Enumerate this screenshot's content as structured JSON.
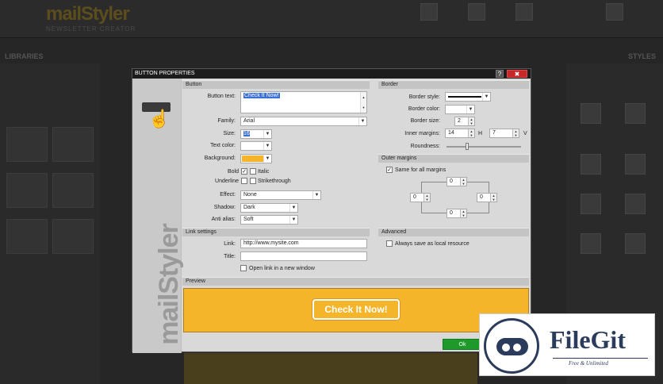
{
  "app": {
    "logo": "mailStyler",
    "logo_sub": "NEWSLETTER CREATOR",
    "libraries_title": "LIBRARIES",
    "styles_title": "STYLES"
  },
  "dialog": {
    "title": "BUTTON PROPERTIES",
    "help_label": "?",
    "close_label": "✖",
    "sidebar_wordmark": "mailStyler",
    "button_section": {
      "header": "Button",
      "button_text_label": "Button text:",
      "button_text_value": "Check It Now!",
      "family_label": "Family:",
      "family_value": "Arial",
      "size_label": "Size:",
      "size_value": "16",
      "text_color_label": "Text color:",
      "background_label": "Background:",
      "background_color": "#f5b52a",
      "bold_label": "Bold",
      "italic_label": "Italic",
      "underline_label": "Underline",
      "strikethrough_label": "Strikethrough",
      "effect_label": "Effect:",
      "effect_value": "None",
      "shadow_label": "Shadow:",
      "shadow_value": "Dark",
      "antialias_label": "Anti alias:",
      "antialias_value": "Soft"
    },
    "border_section": {
      "header": "Border",
      "style_label": "Border style:",
      "color_label": "Border color:",
      "size_label": "Border size:",
      "size_value": "2",
      "inner_margins_label": "Inner margins:",
      "inner_h_value": "14",
      "h_label": "H",
      "inner_v_value": "7",
      "v_label": "V",
      "roundness_label": "Roundness:"
    },
    "outer_margins_section": {
      "header": "Outer margins",
      "same_label": "Same for all margins",
      "top": "0",
      "left": "0",
      "right": "0",
      "bottom": "0"
    },
    "link_section": {
      "header": "Link settings",
      "link_label": "Link:",
      "link_value": "http://www.mysite.com",
      "title_label": "Title:",
      "title_value": "",
      "new_window_label": "Open link in a new window"
    },
    "advanced_section": {
      "header": "Advanced",
      "save_local_label": "Always save as local resource"
    },
    "preview_section": {
      "header": "Preview",
      "button_text": "Check It Now!"
    },
    "ok_label": "Ok"
  },
  "watermark": {
    "name": "FileGit",
    "tagline": "Free & Unlimited"
  }
}
